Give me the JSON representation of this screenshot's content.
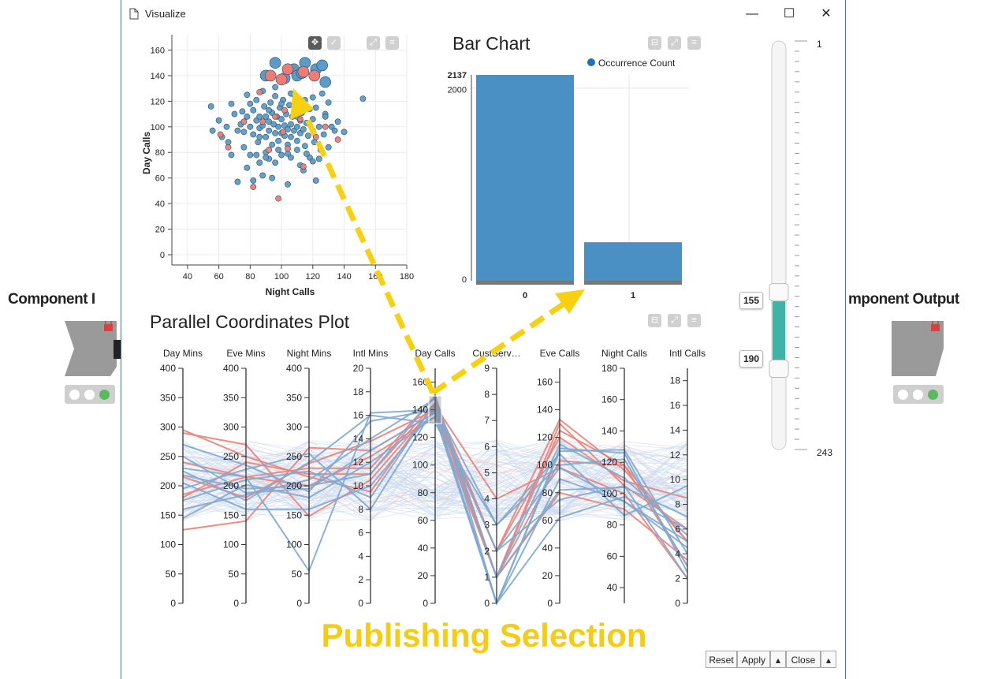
{
  "nodes": {
    "input_label": "Component I",
    "output_label": "mponent Output"
  },
  "window": {
    "title": "Visualize",
    "minimize": "—",
    "maximize": "☐",
    "close": "✕"
  },
  "colors": {
    "blue": "#5b9bc7",
    "red": "#ef7b73",
    "bar": "#4a90c4",
    "highlight_text": "#f5cc12",
    "arrow": "#f7d010",
    "slider_fill": "#3fb4a6"
  },
  "panels": {
    "bar_title": "Bar Chart",
    "pcp_title": "Parallel Coordinates Plot"
  },
  "overlay_text": "Publishing Selection",
  "footer": {
    "reset": "Reset",
    "apply": "Apply",
    "close": "Close"
  },
  "slider": {
    "min_label": "1",
    "max_label": "243",
    "low_value": "155",
    "high_value": "190",
    "min": 1,
    "max": 243,
    "low": 155,
    "high": 190
  },
  "chart_data": [
    {
      "type": "scatter",
      "xlabel": "Night Calls",
      "ylabel": "Day Calls",
      "xlim": [
        30,
        180
      ],
      "ylim": [
        -8,
        172
      ],
      "xticks": [
        "40",
        "60",
        "80",
        "100",
        "120",
        "140",
        "160",
        "180"
      ],
      "yticks": [
        "0",
        "20",
        "40",
        "60",
        "80",
        "100",
        "120",
        "140",
        "160"
      ],
      "series": [
        {
          "color": "blue",
          "points": [
            [
              55,
              116
            ],
            [
              56,
              97
            ],
            [
              60,
              105
            ],
            [
              62,
              92
            ],
            [
              65,
              100
            ],
            [
              66,
              88
            ],
            [
              68,
              118
            ],
            [
              70,
              110
            ],
            [
              72,
              97
            ],
            [
              74,
              102
            ],
            [
              75,
              112
            ],
            [
              76,
              96
            ],
            [
              78,
              125
            ],
            [
              78,
              108
            ],
            [
              80,
              118
            ],
            [
              80,
              100
            ],
            [
              82,
              113
            ],
            [
              82,
              94
            ],
            [
              84,
              121
            ],
            [
              84,
              105
            ],
            [
              85,
              88
            ],
            [
              86,
              108
            ],
            [
              86,
              99
            ],
            [
              88,
              128
            ],
            [
              88,
              101
            ],
            [
              89,
              116
            ],
            [
              90,
              92
            ],
            [
              90,
              108
            ],
            [
              92,
              104
            ],
            [
              92,
              97
            ],
            [
              93,
              119
            ],
            [
              94,
              86
            ],
            [
              94,
              111
            ],
            [
              95,
              102
            ],
            [
              96,
              124
            ],
            [
              96,
              95
            ],
            [
              97,
              108
            ],
            [
              98,
              89
            ],
            [
              98,
              100
            ],
            [
              99,
              115
            ],
            [
              100,
              106
            ],
            [
              100,
              95
            ],
            [
              101,
              121
            ],
            [
              102,
              101
            ],
            [
              102,
              93
            ],
            [
              103,
              110
            ],
            [
              104,
              98
            ],
            [
              104,
              86
            ],
            [
              105,
              117
            ],
            [
              106,
              102
            ],
            [
              106,
              92
            ],
            [
              107,
              108
            ],
            [
              108,
              97
            ],
            [
              108,
              125
            ],
            [
              109,
              112
            ],
            [
              110,
              100
            ],
            [
              110,
              89
            ],
            [
              111,
              119
            ],
            [
              112,
              105
            ],
            [
              112,
              95
            ],
            [
              113,
              111
            ],
            [
              114,
              98
            ],
            [
              115,
              121
            ],
            [
              115,
              85
            ],
            [
              116,
              103
            ],
            [
              117,
              93
            ],
            [
              118,
              114
            ],
            [
              118,
              76
            ],
            [
              120,
              106
            ],
            [
              120,
              97
            ],
            [
              121,
              88
            ],
            [
              122,
              115
            ],
            [
              124,
              100
            ],
            [
              125,
              82
            ],
            [
              126,
              126
            ],
            [
              127,
              94
            ],
            [
              128,
              110
            ],
            [
              130,
              84
            ],
            [
              130,
              119
            ],
            [
              132,
              100
            ],
            [
              134,
              97
            ],
            [
              136,
              104
            ],
            [
              86,
              72
            ],
            [
              84,
              78
            ],
            [
              90,
              80
            ],
            [
              92,
              75
            ],
            [
              96,
              72
            ],
            [
              98,
              82
            ],
            [
              100,
              78
            ],
            [
              104,
              79
            ],
            [
              106,
              76
            ],
            [
              110,
              82
            ],
            [
              112,
              70
            ],
            [
              116,
              79
            ],
            [
              120,
              73
            ],
            [
              124,
              75
            ],
            [
              80,
              78
            ],
            [
              88,
              62
            ],
            [
              78,
              68
            ],
            [
              82,
              58
            ],
            [
              72,
              57
            ],
            [
              94,
              60
            ],
            [
              104,
              55
            ],
            [
              114,
              66
            ],
            [
              122,
              58
            ],
            [
              90,
              76
            ],
            [
              76,
              84
            ],
            [
              68,
              78
            ],
            [
              152,
              122
            ],
            [
              140,
              96
            ],
            [
              100,
              118
            ],
            [
              106,
              126
            ],
            [
              96,
              131
            ],
            [
              92,
              113
            ],
            [
              120,
              123
            ],
            [
              128,
              108
            ],
            [
              86,
              92
            ],
            [
              110,
              108
            ]
          ],
          "big_points": [
            [
              90,
              140
            ],
            [
              96,
              150
            ],
            [
              102,
              138
            ],
            [
              108,
              145
            ],
            [
              115,
              150
            ],
            [
              122,
              145
            ],
            [
              126,
              148
            ],
            [
              128,
              135
            ],
            [
              110,
              140
            ],
            [
              113,
              142
            ]
          ]
        },
        {
          "color": "red",
          "points": [
            [
              61,
              94
            ],
            [
              66,
              84
            ],
            [
              76,
              104
            ],
            [
              86,
              127
            ],
            [
              92,
              82
            ],
            [
              96,
              108
            ],
            [
              101,
              96
            ],
            [
              104,
              83
            ],
            [
              112,
              106
            ],
            [
              114,
              69
            ],
            [
              122,
              92
            ],
            [
              136,
              90
            ],
            [
              98,
              44
            ],
            [
              82,
              53
            ],
            [
              88,
              104
            ],
            [
              102,
              113
            ],
            [
              128,
              100
            ]
          ],
          "big_points": [
            [
              100,
              137
            ],
            [
              104,
              145
            ],
            [
              114,
              143
            ],
            [
              121,
              140
            ],
            [
              93,
              140
            ]
          ]
        }
      ]
    },
    {
      "type": "bar",
      "title": "Bar Chart",
      "legend": [
        "Occurrence Count"
      ],
      "categories": [
        "0",
        "1"
      ],
      "values": [
        2137,
        400
      ],
      "yticks": [
        "0",
        "2000"
      ],
      "max_label": "2137",
      "ylim": [
        0,
        2137
      ],
      "legend_position": "top-right"
    },
    {
      "type": "parallel-coordinates",
      "title": "Parallel Coordinates Plot",
      "axes": [
        {
          "name": "Day Mins",
          "min": 0,
          "max": 400,
          "ticks": [
            "0",
            "50",
            "100",
            "150",
            "200",
            "250",
            "300",
            "350",
            "400"
          ]
        },
        {
          "name": "Eve Mins",
          "min": 0,
          "max": 400,
          "ticks": [
            "0",
            "50",
            "100",
            "150",
            "200",
            "250",
            "300",
            "350",
            "400"
          ]
        },
        {
          "name": "Night Mins",
          "min": 0,
          "max": 400,
          "ticks": [
            "0",
            "50",
            "100",
            "150",
            "200",
            "250",
            "300",
            "350",
            "400"
          ]
        },
        {
          "name": "Intl Mins",
          "min": 0,
          "max": 20,
          "ticks": [
            "0",
            "2",
            "4",
            "6",
            "8",
            "10",
            "12",
            "14",
            "16",
            "18",
            "20"
          ]
        },
        {
          "name": "Day Calls",
          "min": 0,
          "max": 170,
          "ticks": [
            "0",
            "20",
            "40",
            "60",
            "80",
            "100",
            "120",
            "140",
            "160"
          ]
        },
        {
          "name": "CustServ…",
          "min": 0,
          "max": 9,
          "ticks": [
            "0",
            "1",
            "2",
            "3",
            "4",
            "5",
            "6",
            "7",
            "8",
            "9"
          ]
        },
        {
          "name": "Eve Calls",
          "min": 0,
          "max": 170,
          "ticks": [
            "0",
            "20",
            "40",
            "60",
            "80",
            "100",
            "120",
            "140",
            "160"
          ]
        },
        {
          "name": "Night Calls",
          "min": 30,
          "max": 180,
          "ticks": [
            "40",
            "60",
            "80",
            "100",
            "120",
            "140",
            "160",
            "180"
          ]
        },
        {
          "name": "Intl Calls",
          "min": 0,
          "max": 19,
          "ticks": [
            "0",
            "2",
            "4",
            "6",
            "8",
            "10",
            "12",
            "14",
            "16",
            "18"
          ]
        }
      ],
      "brush": {
        "axis": "Day Calls",
        "from": 130,
        "to": 150
      },
      "lines": [
        {
          "color": "red",
          "values": [
            295,
            250,
            215,
            9.5,
            145,
            2,
            133,
            115,
            5
          ]
        },
        {
          "color": "red",
          "values": [
            185,
            215,
            230,
            11.5,
            150,
            1,
            125,
            118,
            3
          ]
        },
        {
          "color": "red",
          "values": [
            125,
            140,
            265,
            13,
            138,
            2,
            120,
            108,
            8.5
          ]
        },
        {
          "color": "red",
          "values": [
            290,
            270,
            148,
            10.5,
            143,
            4,
            98,
            100,
            2
          ]
        },
        {
          "color": "red",
          "values": [
            215,
            180,
            238,
            13.8,
            140,
            1,
            80,
            90,
            3.5
          ]
        },
        {
          "color": "red",
          "values": [
            240,
            215,
            200,
            12.5,
            135,
            1,
            103,
            118,
            5
          ]
        },
        {
          "color": "red",
          "values": [
            180,
            240,
            220,
            11,
            145,
            1,
            130,
            105,
            6
          ]
        },
        {
          "color": "blue",
          "values": [
            270,
            235,
            190,
            15.5,
            140,
            0,
            110,
            128,
            4
          ]
        },
        {
          "color": "blue",
          "values": [
            230,
            215,
            55,
            16.2,
            140,
            2,
            98,
            95,
            5
          ]
        },
        {
          "color": "blue",
          "values": [
            218,
            195,
            200,
            11,
            150,
            0,
            112,
            126,
            2.5
          ]
        },
        {
          "color": "blue",
          "values": [
            195,
            228,
            255,
            8,
            142,
            3,
            100,
            122,
            3
          ]
        },
        {
          "color": "blue",
          "values": [
            160,
            185,
            210,
            14,
            148,
            1,
            115,
            110,
            5.5
          ]
        },
        {
          "color": "blue",
          "values": [
            145,
            202,
            180,
            12,
            135,
            0,
            62,
            98,
            6
          ]
        },
        {
          "color": "blue",
          "values": [
            205,
            160,
            160,
            10,
            140,
            2,
            75,
            105,
            2
          ]
        },
        {
          "color": "blue",
          "values": [
            225,
            175,
            240,
            16,
            130,
            3,
            108,
            86,
            9.5
          ]
        },
        {
          "color": "blue",
          "values": [
            175,
            210,
            225,
            9,
            145,
            1,
            82,
            104,
            7
          ]
        },
        {
          "color": "blue",
          "values": [
            250,
            188,
            195,
            13,
            138,
            0,
            90,
            95,
            4.5
          ]
        }
      ]
    }
  ]
}
